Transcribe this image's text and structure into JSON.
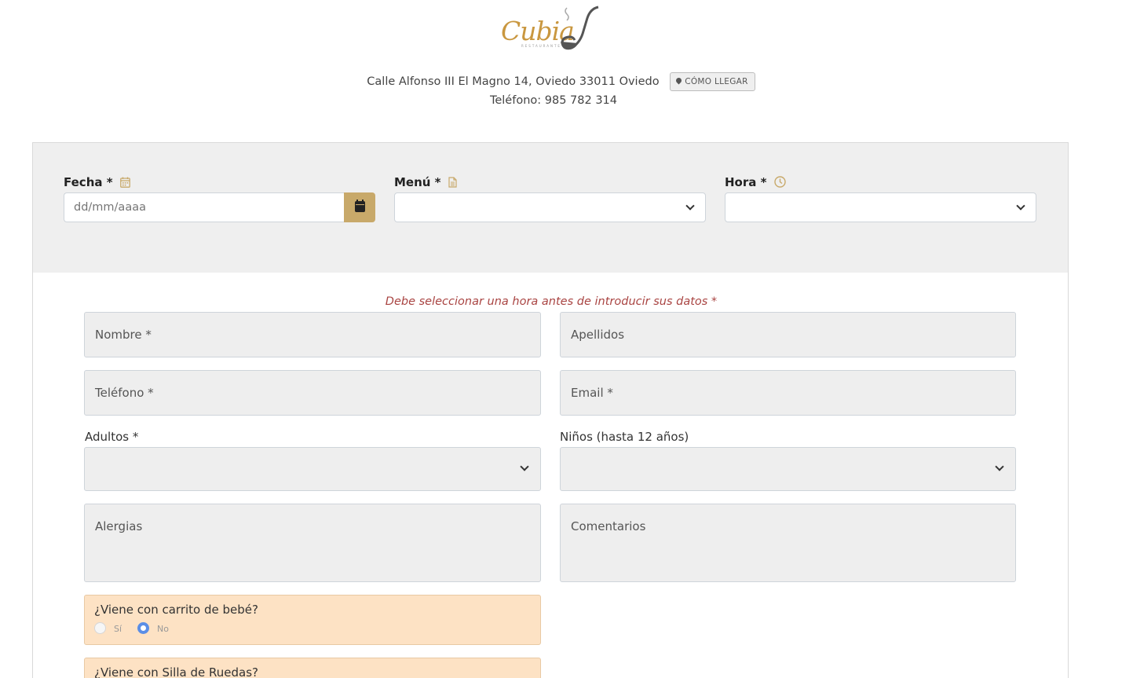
{
  "header": {
    "logo_text": "Cubia",
    "logo_subtext": "RESTAURANTE",
    "address": "Calle Alfonso III El Magno 14, Oviedo 33011 Oviedo",
    "directions_button": "CÓMO LLEGAR",
    "phone": "Teléfono: 985 782 314"
  },
  "booking": {
    "fecha_label": "Fecha *",
    "fecha_placeholder": "dd/mm/aaaa",
    "menu_label": "Menú *",
    "menu_value": "",
    "hora_label": "Hora *",
    "hora_value": ""
  },
  "form": {
    "warning": "Debe seleccionar una hora antes de introducir sus datos *",
    "nombre": "Nombre *",
    "apellidos": "Apellidos",
    "telefono": "Teléfono *",
    "email": "Email *",
    "adultos_label": "Adultos *",
    "ninos_label": "Niños (hasta 12 años)",
    "alergias": "Alergias",
    "comentarios": "Comentarios",
    "carrito_question": "¿Viene con carrito de bebé?",
    "option_si": "Sí",
    "option_no": "No",
    "carrito_selected": "No",
    "silla_question": "¿Viene con Silla de Ruedas?"
  },
  "colors": {
    "accent_gold": "#c8a96a",
    "warning_text": "#a94442",
    "note_background": "#fde2c4",
    "radio_checked": "#5b8ee6"
  }
}
